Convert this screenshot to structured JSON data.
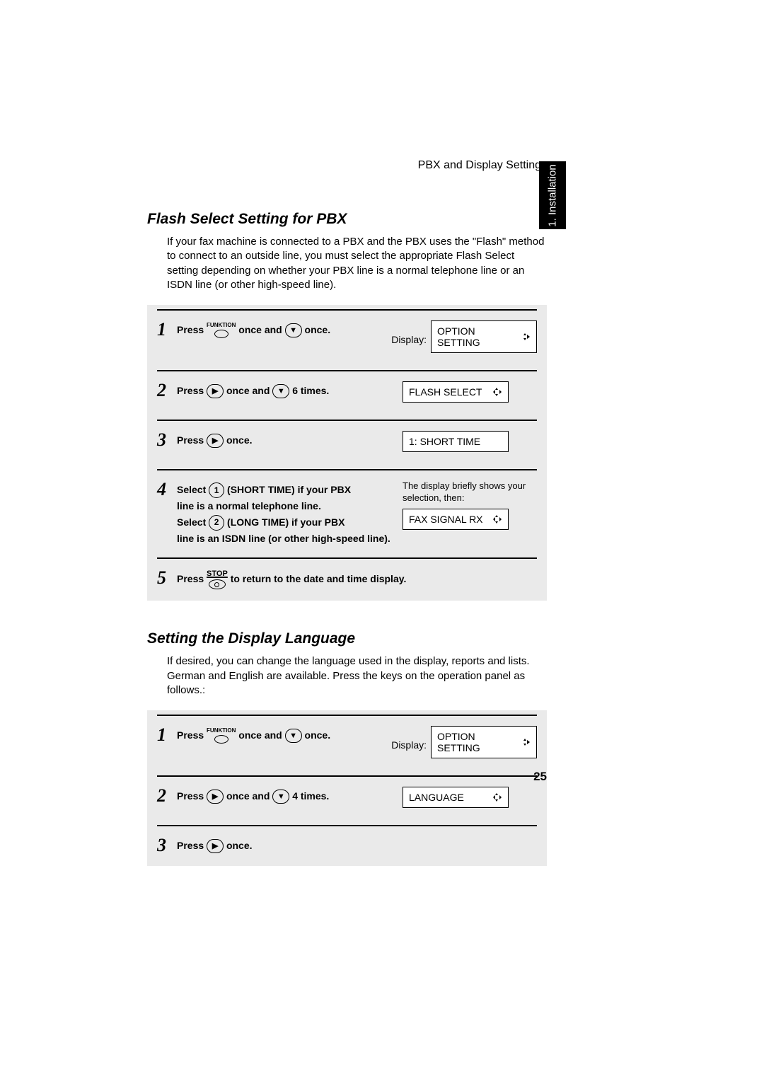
{
  "header": "PBX and Display Settings",
  "side_tab": "1. Installation",
  "section1": {
    "title": "Flash Select Setting for PBX",
    "intro": "If your fax machine is connected to a PBX and the PBX uses the \"Flash\" method to connect to an outside line, you must select the appropriate Flash Select setting depending on whether your PBX line is a normal telephone line or an ISDN line (or other high-speed line).",
    "steps": {
      "s1": {
        "num": "1",
        "press": "Press",
        "onceand": "once and",
        "once": "once.",
        "display_label": "Display:",
        "lcd": "OPTION SETTING"
      },
      "s2": {
        "num": "2",
        "press": "Press",
        "onceand": "once and",
        "times": "6 times.",
        "lcd": "FLASH SELECT"
      },
      "s3": {
        "num": "3",
        "press": "Press",
        "once": "once.",
        "lcd": "1: SHORT TIME"
      },
      "s4": {
        "num": "4",
        "select": "Select",
        "line1a": "(SHORT TIME) if your PBX",
        "line1b": "line is a normal telephone line.",
        "line2a": "(LONG TIME) if your PBX",
        "line2b": "line is an ISDN line (or other high-speed line).",
        "note": "The display briefly shows your selection, then:",
        "lcd": "FAX SIGNAL RX"
      },
      "s5": {
        "num": "5",
        "press": "Press",
        "tail": "to return to the date and time display."
      }
    }
  },
  "section2": {
    "title": "Setting the Display Language",
    "intro": "If desired, you can change the language used in the display, reports and lists. German and English are available. Press the keys on the operation panel as follows.:",
    "steps": {
      "s1": {
        "num": "1",
        "press": "Press",
        "onceand": "once and",
        "once": "once.",
        "display_label": "Display:",
        "lcd": "OPTION SETTING"
      },
      "s2": {
        "num": "2",
        "press": "Press",
        "onceand": "once and",
        "times": "4 times.",
        "lcd": "LANGUAGE"
      },
      "s3": {
        "num": "3",
        "press": "Press",
        "once": "once."
      }
    }
  },
  "keys": {
    "funktion": "FUNKTION",
    "stop": "STOP",
    "k1": "1",
    "k2": "2"
  },
  "page_number": "25"
}
